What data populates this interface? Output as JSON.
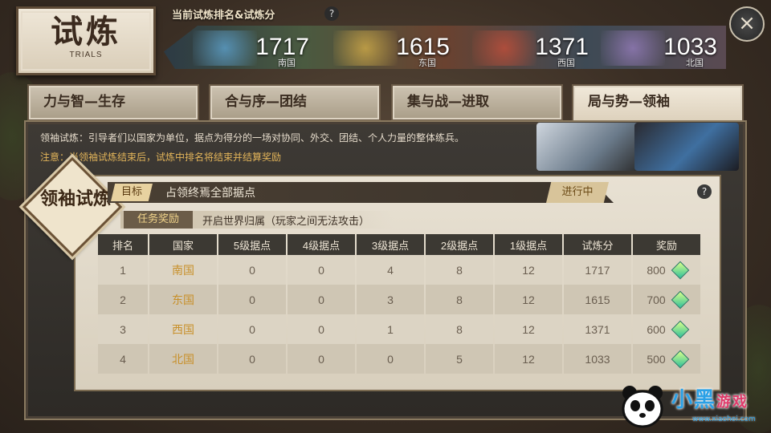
{
  "title": {
    "main": "试炼",
    "sub": "TRIALS"
  },
  "ranking": {
    "caption": "当前试炼排名&试炼分",
    "help": "?",
    "nations": [
      {
        "name": "南国",
        "score": "1717",
        "color": "#3a7fb0"
      },
      {
        "name": "东国",
        "score": "1615",
        "color": "#c9a03a"
      },
      {
        "name": "西国",
        "score": "1371",
        "color": "#b03a2e"
      },
      {
        "name": "北国",
        "score": "1033",
        "color": "#8a6fb0"
      }
    ]
  },
  "close_icon": "×",
  "tabs": [
    {
      "label": "力与智—生存",
      "active": false
    },
    {
      "label": "合与序—团结",
      "active": false
    },
    {
      "label": "集与战—进取",
      "active": false
    },
    {
      "label": "局与势—领袖",
      "active": true
    }
  ],
  "panel": {
    "description": "领袖试炼：引导者们以国家为单位，据点为得分的一场对协同、外交、团结、个人力量的整体练兵。",
    "note": "注意：当领袖试炼结束后，试炼中排名将结束并结算奖励",
    "badge": "领袖试炼",
    "goal_label": "目标",
    "goal_text": "占领终焉全部据点",
    "status": "进行中",
    "help": "?",
    "reward_label": "任务奖励",
    "reward_text": "开启世界归属（玩家之间无法攻击）"
  },
  "table": {
    "headers": [
      "排名",
      "国家",
      "5级据点",
      "4级据点",
      "3级据点",
      "2级据点",
      "1级据点",
      "试炼分",
      "奖励"
    ],
    "rows": [
      [
        "1",
        "南国",
        "0",
        "0",
        "4",
        "8",
        "12",
        "1717",
        "800"
      ],
      [
        "2",
        "东国",
        "0",
        "0",
        "3",
        "8",
        "12",
        "1615",
        "700"
      ],
      [
        "3",
        "西国",
        "0",
        "0",
        "1",
        "8",
        "12",
        "1371",
        "600"
      ],
      [
        "4",
        "北国",
        "0",
        "0",
        "0",
        "5",
        "12",
        "1033",
        "500"
      ]
    ]
  },
  "watermark": {
    "brand": "小黑",
    "brand2": "游戏",
    "url": "www.xiaohei.com"
  }
}
